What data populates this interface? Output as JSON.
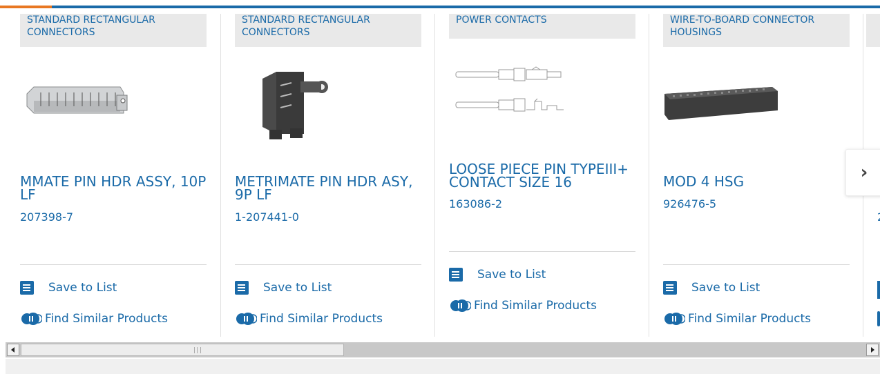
{
  "products": [
    {
      "category": "STANDARD RECTANGULAR CONNECTORS",
      "title": "MMATE PIN HDR ASSY, 10P LF",
      "part_number": "207398-7",
      "image": "rectangular-header-10p"
    },
    {
      "category": "STANDARD RECTANGULAR CONNECTORS",
      "title": "METRIMATE PIN HDR ASY, 9P LF",
      "part_number": "1-207441-0",
      "image": "metrimate-header-9p"
    },
    {
      "category": "POWER CONTACTS",
      "title": "LOOSE PIECE PIN TYPEIII+ CONTACT SIZE 16",
      "part_number": "163086-2",
      "image": "pin-contacts"
    },
    {
      "category": "WIRE-TO-BOARD CONNECTOR HOUSINGS",
      "title": "MOD 4 HSG",
      "part_number": "926476-5",
      "image": "connector-housing"
    }
  ],
  "actions": {
    "save": "Save to List",
    "similar": "Find Similar Products"
  },
  "partial_next": {
    "part_number": "2"
  },
  "nav": {
    "next_glyph": "›"
  },
  "colors": {
    "accent_blue": "#1a6aa8",
    "accent_orange": "#e87722"
  }
}
